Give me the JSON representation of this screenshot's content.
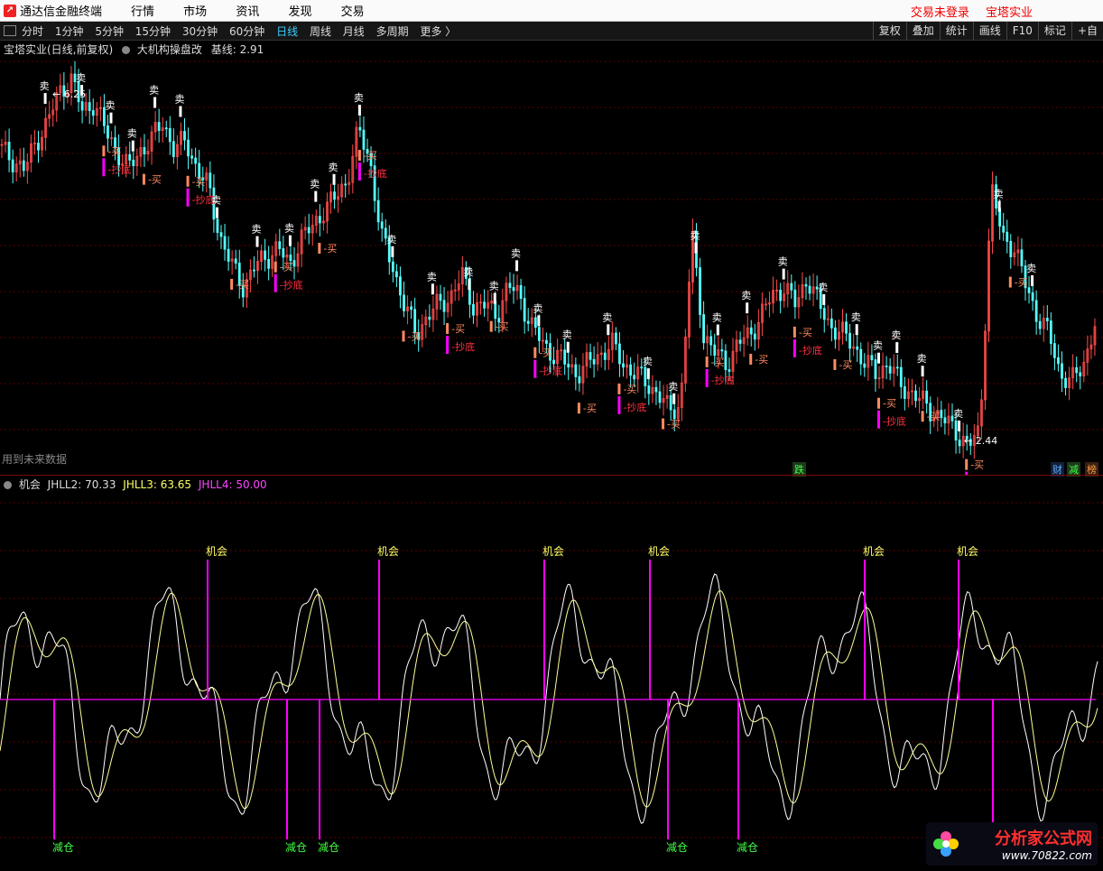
{
  "app": {
    "title": "通达信金融终端"
  },
  "menu": [
    "行情",
    "市场",
    "资讯",
    "发现",
    "交易"
  ],
  "login": {
    "status": "交易未登录",
    "stock": "宝塔实业"
  },
  "periods": [
    "分时",
    "1分钟",
    "5分钟",
    "15分钟",
    "30分钟",
    "60分钟",
    "日线",
    "周线",
    "月线",
    "多周期",
    "更多 〉"
  ],
  "active_period": "日线",
  "tools": [
    "复权",
    "叠加",
    "统计",
    "画线",
    "F10",
    "标记",
    "+自"
  ],
  "main": {
    "title": "宝塔实业(日线,前复权)",
    "indicator": "大机构操盘改",
    "base_label": "基线:",
    "base_value": "2.91",
    "high_label": "6.25",
    "low_label": "2.44",
    "future_note": "用到未来数据",
    "sell": "卖",
    "buy": "买",
    "bottom": "抄底",
    "badges": [
      "跌",
      "财",
      "减",
      "榜"
    ]
  },
  "sub": {
    "name": "机会",
    "jhll2": "JHLL2: 70.33",
    "jhll3": "JHLL3: 63.65",
    "jhll4": "JHLL4: 50.00",
    "up_label": "机会",
    "down_label": "减仓"
  },
  "watermark": {
    "text": "分析家公式网",
    "url": "www.70822.com"
  },
  "colors": {
    "up": "#ff4b4b",
    "down": "#54ffff",
    "magenta": "#ff00ff",
    "yellow": "#ffff99"
  },
  "chart_data": {
    "type": "line",
    "candles_close": [
      5.5,
      5.4,
      5.3,
      5.6,
      5.8,
      6.1,
      6.25,
      5.9,
      6.0,
      5.7,
      5.5,
      5.3,
      5.5,
      5.6,
      5.8,
      5.5,
      5.6,
      5.3,
      5.1,
      4.6,
      4.3,
      4.1,
      4.3,
      4.4,
      4.5,
      4.3,
      4.6,
      4.7,
      4.9,
      5.0,
      5.2,
      5.7,
      5.4,
      4.6,
      4.3,
      3.9,
      3.6,
      3.8,
      3.9,
      4.0,
      4.2,
      3.9,
      3.9,
      3.8,
      4.1,
      4.0,
      3.7,
      3.5,
      3.4,
      3.3,
      3.2,
      3.3,
      3.4,
      3.5,
      3.3,
      3.2,
      3.1,
      3.0,
      2.8,
      2.9,
      4.6,
      3.6,
      3.4,
      3.3,
      3.5,
      3.6,
      3.8,
      4.0,
      4.1,
      3.9,
      4.2,
      3.9,
      3.7,
      3.6,
      3.5,
      3.3,
      3.2,
      3.3,
      3.1,
      3.0,
      2.9,
      2.8,
      2.7,
      2.6,
      2.44,
      2.6,
      5.1,
      4.6,
      4.5,
      4.1,
      3.8,
      3.6,
      3.2,
      3.1,
      3.3,
      3.7
    ],
    "sell_count": 34,
    "buy_count": 22,
    "opportunity_count": 6,
    "reduce_count": 6
  }
}
